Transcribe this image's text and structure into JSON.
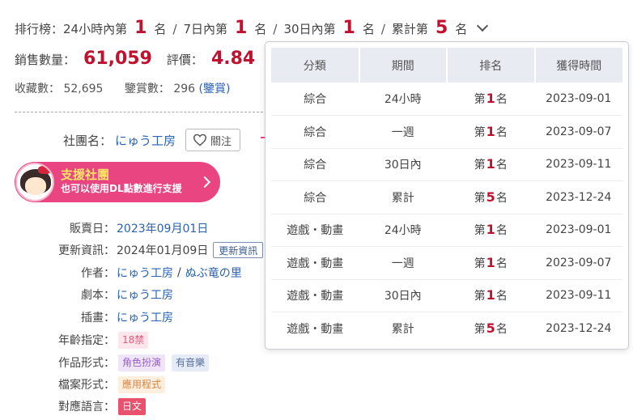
{
  "ranking": {
    "label": "排行榜：",
    "items": [
      {
        "prefix": "24小時內第",
        "rank": "1",
        "suffix": "名"
      },
      {
        "prefix": "7日內第",
        "rank": "1",
        "suffix": "名"
      },
      {
        "prefix": "30日內第",
        "rank": "1",
        "suffix": "名"
      },
      {
        "prefix": "累計第",
        "rank": "5",
        "suffix": "名"
      }
    ],
    "separator": "/"
  },
  "sales": {
    "label": "銷售數量：",
    "value": "61,059"
  },
  "rating": {
    "label": "評價：",
    "value": "4.84"
  },
  "favorites": {
    "label": "收藏數：",
    "value": "52,695"
  },
  "reviews": {
    "label": "鑒賞數：",
    "value": "296",
    "link_label": "(鑒賞)"
  },
  "circle": {
    "label": "社團名：",
    "name": "にゅう工房",
    "follow_label": "關注"
  },
  "support_banner": {
    "title": "支援社團",
    "subtitle": "也可以使用DL點數進行支援"
  },
  "info": {
    "release": {
      "label": "販賣日：",
      "value": "2023年09月01日"
    },
    "update": {
      "label": "更新資訊：",
      "value": "2024年01月09日",
      "button": "更新資訊"
    },
    "author": {
      "label": "作者：",
      "value1": "にゅう工房",
      "sep": "/",
      "value2": "ぬぶ竜の里"
    },
    "scenario": {
      "label": "劇本：",
      "value": "にゅう工房"
    },
    "illust": {
      "label": "插畫：",
      "value": "にゅう工房"
    },
    "age": {
      "label": "年齡指定：",
      "tag": "18禁"
    },
    "format": {
      "label": "作品形式：",
      "tags": [
        "角色扮演",
        "有音樂"
      ]
    },
    "file": {
      "label": "檔案形式：",
      "tag": "應用程式"
    },
    "lang": {
      "label": "對應語言：",
      "tag": "日文"
    }
  },
  "ranking_table": {
    "headers": [
      "分類",
      "期間",
      "排名",
      "獲得時間"
    ],
    "rank_prefix": "第",
    "rank_suffix": "名",
    "rows": [
      {
        "category": "綜合",
        "period": "24小時",
        "rank": "1",
        "date": "2023-09-01"
      },
      {
        "category": "綜合",
        "period": "一週",
        "rank": "1",
        "date": "2023-09-07"
      },
      {
        "category": "綜合",
        "period": "30日內",
        "rank": "1",
        "date": "2023-09-11"
      },
      {
        "category": "綜合",
        "period": "累計",
        "rank": "5",
        "date": "2023-12-24"
      },
      {
        "category": "遊戲・動畫",
        "period": "24小時",
        "rank": "1",
        "date": "2023-09-01"
      },
      {
        "category": "遊戲・動畫",
        "period": "一週",
        "rank": "1",
        "date": "2023-09-07"
      },
      {
        "category": "遊戲・動畫",
        "period": "30日內",
        "rank": "1",
        "date": "2023-09-11"
      },
      {
        "category": "遊戲・動畫",
        "period": "累計",
        "rank": "5",
        "date": "2023-12-24"
      }
    ]
  },
  "colors": {
    "accent_red": "#c0122f",
    "link_blue": "#2a62b5",
    "support_pink": "#e94581"
  }
}
